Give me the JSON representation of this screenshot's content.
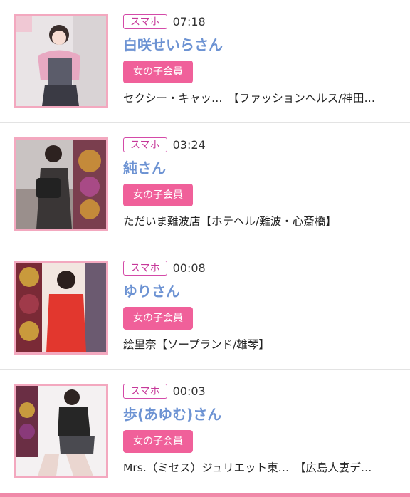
{
  "entries": [
    {
      "device": "スマホ",
      "time": "07:18",
      "name": "白咲せいらさん",
      "badge": "女の子会員",
      "shop": "セクシー・キャッ…　【ファッションヘルス/神田…"
    },
    {
      "device": "スマホ",
      "time": "03:24",
      "name": "純さん",
      "badge": "女の子会員",
      "shop": "ただいま難波店【ホテヘル/難波・心斎橋】"
    },
    {
      "device": "スマホ",
      "time": "00:08",
      "name": "ゆりさん",
      "badge": "女の子会員",
      "shop": "絵里奈【ソープランド/雄琴】"
    },
    {
      "device": "スマホ",
      "time": "00:03",
      "name": "歩(あゆむ)さん",
      "badge": "女の子会員",
      "shop": "Mrs.（ミセス）ジュリエット東…　【広島人妻デ…"
    }
  ],
  "colors": {
    "name": "#6d93d3",
    "device_border": "#d44aa8",
    "badge_bg": "#f0609a",
    "thumb_border": "#f3a8bf",
    "bottom_bar": "#f08aa9"
  }
}
